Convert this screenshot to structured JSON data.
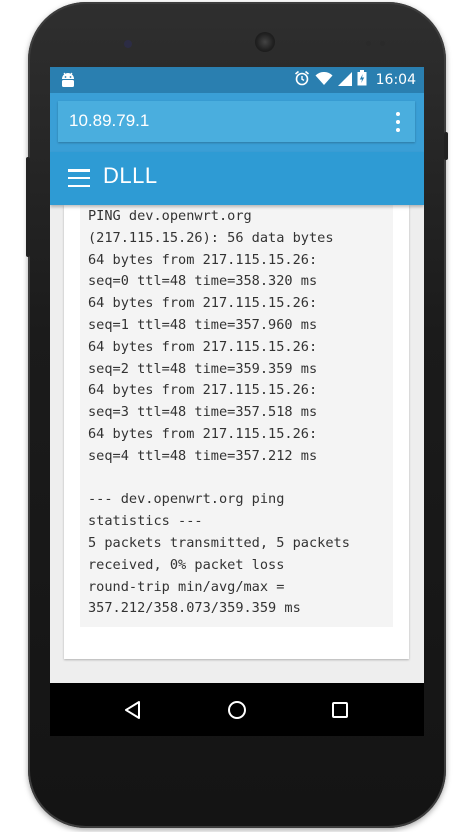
{
  "status_bar": {
    "time": "16:04",
    "icons": [
      "android-icon",
      "alarm-icon",
      "wifi-icon",
      "cell-signal-icon",
      "battery-charging-icon"
    ]
  },
  "url_bar": {
    "address": "10.89.79.1",
    "menu_icon": "overflow-menu-icon"
  },
  "app_bar": {
    "title": "DLLL",
    "menu_icon": "hamburger-menu-icon"
  },
  "output": {
    "text": "PING dev.openwrt.org\n(217.115.15.26): 56 data bytes\n64 bytes from 217.115.15.26:\nseq=0 ttl=48 time=358.320 ms\n64 bytes from 217.115.15.26:\nseq=1 ttl=48 time=357.960 ms\n64 bytes from 217.115.15.26:\nseq=2 ttl=48 time=359.359 ms\n64 bytes from 217.115.15.26:\nseq=3 ttl=48 time=357.518 ms\n64 bytes from 217.115.15.26:\nseq=4 ttl=48 time=357.212 ms\n\n--- dev.openwrt.org ping\nstatistics ---\n5 packets transmitted, 5 packets\nreceived, 0% packet loss\nround-trip min/avg/max =\n357.212/358.073/359.359 ms"
  },
  "nav_bar": {
    "buttons": [
      "back-icon",
      "home-icon",
      "recents-icon"
    ]
  },
  "colors": {
    "status_bar": "#2a7fb0",
    "url_bar": "#3a9fd6",
    "app_bar": "#2e9bd4",
    "text": "#333333"
  }
}
